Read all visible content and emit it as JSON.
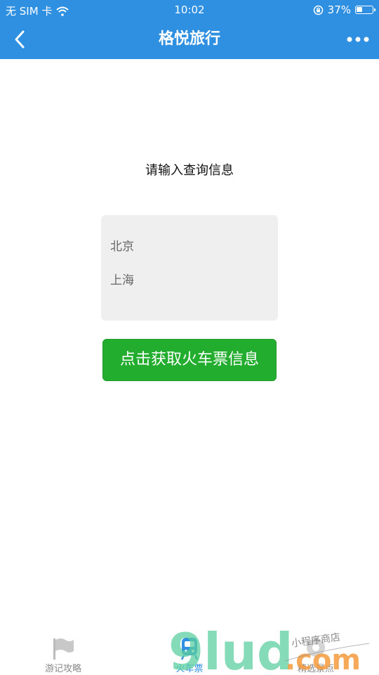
{
  "status_bar": {
    "carrier": "无 SIM 卡",
    "time": "10:02",
    "battery": "37%",
    "battery_level": 0.37
  },
  "nav": {
    "title": "格悦旅行"
  },
  "main": {
    "prompt": "请输入查询信息",
    "from_city": "北京",
    "to_city": "上海",
    "submit_label": "点击获取火车票信息"
  },
  "tabs": [
    {
      "label": "游记攻略",
      "icon": "flag-icon"
    },
    {
      "label": "火车票",
      "icon": "train-icon"
    },
    {
      "label": "精选景点",
      "icon": "spot-icon"
    }
  ],
  "colors": {
    "primary": "#2f8fe0",
    "button_green": "#23ad2f",
    "card_gray": "#efefef"
  },
  "watermark": {
    "brand": "9lud",
    "suffix": ".com",
    "handwriting": "小程序商店"
  }
}
